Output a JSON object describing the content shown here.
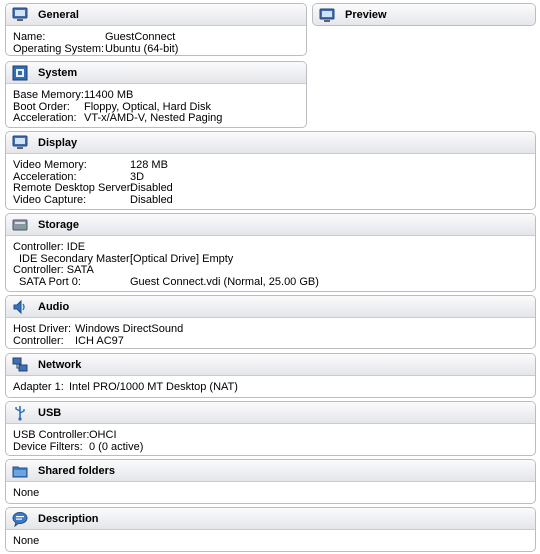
{
  "general": {
    "title": "General",
    "rows": [
      {
        "label": "Name:",
        "value": "GuestConnect"
      },
      {
        "label": "Operating System:",
        "value": "Ubuntu (64-bit)"
      }
    ]
  },
  "preview": {
    "title": "Preview"
  },
  "system": {
    "title": "System",
    "rows": [
      {
        "label": "Base Memory:",
        "value": "11400 MB"
      },
      {
        "label": "Boot Order:",
        "value": "Floppy, Optical, Hard Disk"
      },
      {
        "label": "Acceleration:",
        "value": "VT-x/AMD-V, Nested Paging"
      }
    ]
  },
  "display": {
    "title": "Display",
    "rows": [
      {
        "label": "Video Memory:",
        "value": "128 MB"
      },
      {
        "label": "Acceleration:",
        "value": "3D"
      },
      {
        "label": "Remote Desktop Server:",
        "value": "Disabled"
      },
      {
        "label": "Video Capture:",
        "value": "Disabled"
      }
    ]
  },
  "storage": {
    "title": "Storage",
    "rows": [
      {
        "label": "Controller: IDE",
        "value": ""
      },
      {
        "label": "IDE Secondary Master:",
        "value": "[Optical Drive] Empty"
      },
      {
        "label": "Controller: SATA",
        "value": ""
      },
      {
        "label": "SATA Port 0:",
        "value": "Guest Connect.vdi (Normal, 25.00 GB)"
      }
    ]
  },
  "audio": {
    "title": "Audio",
    "rows": [
      {
        "label": "Host Driver:",
        "value": "Windows DirectSound"
      },
      {
        "label": "Controller:",
        "value": "ICH AC97"
      }
    ]
  },
  "network": {
    "title": "Network",
    "rows": [
      {
        "label": "Adapter 1:",
        "value": "Intel PRO/1000 MT Desktop (NAT)"
      }
    ]
  },
  "usb": {
    "title": "USB",
    "rows": [
      {
        "label": "USB Controller:",
        "value": "OHCI"
      },
      {
        "label": "Device Filters:",
        "value": "0 (0 active)"
      }
    ]
  },
  "shared": {
    "title": "Shared folders",
    "rows": [
      {
        "label": "None",
        "value": ""
      }
    ]
  },
  "description": {
    "title": "Description",
    "rows": [
      {
        "label": "None",
        "value": ""
      }
    ]
  }
}
